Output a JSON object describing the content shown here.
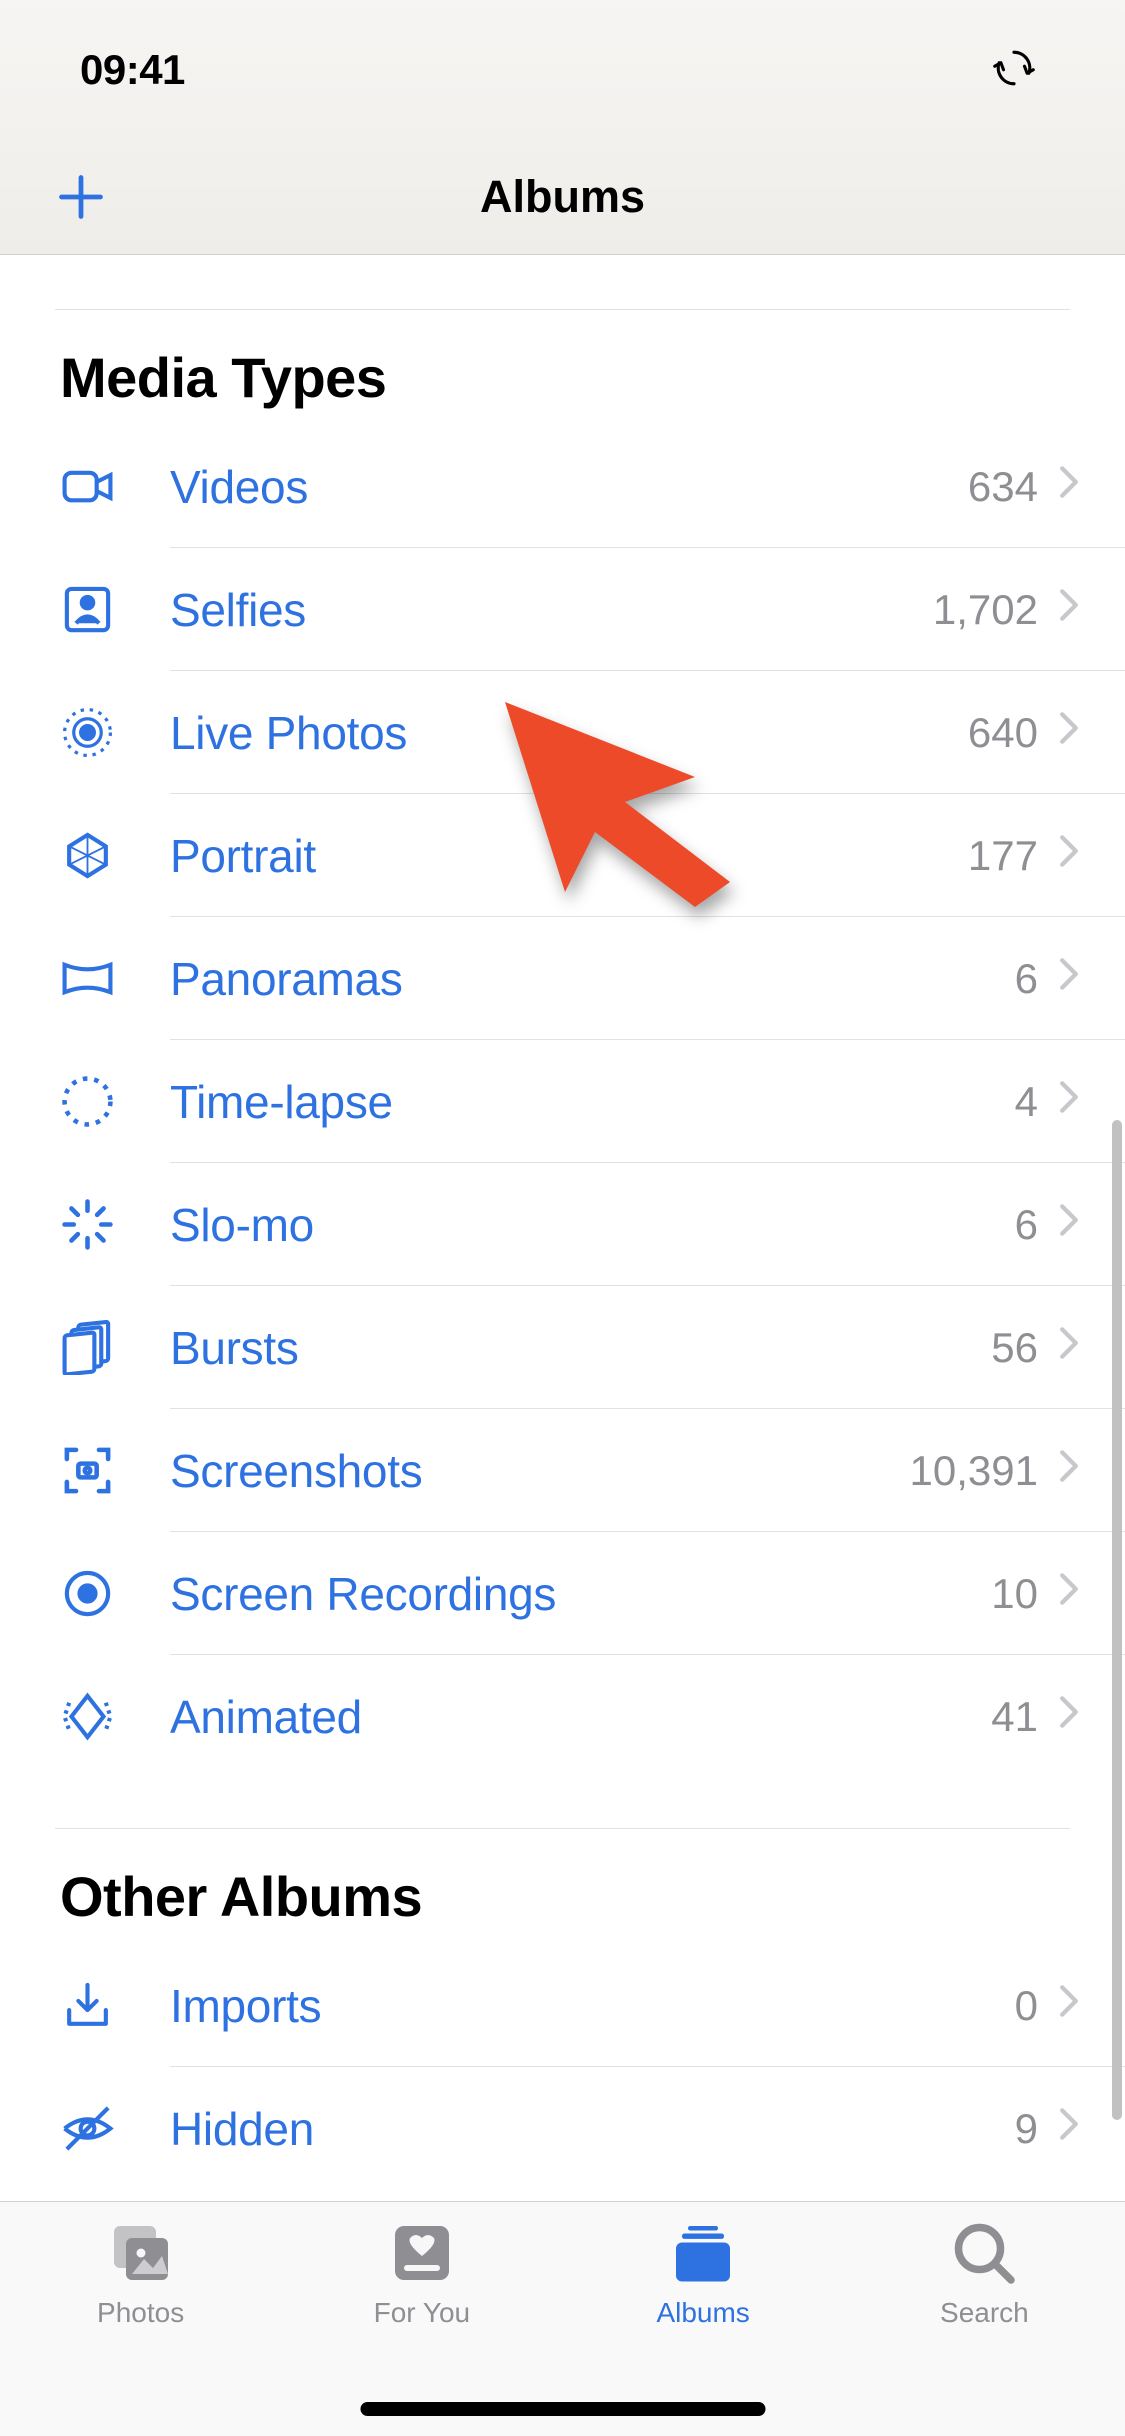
{
  "status": {
    "time": "09:41"
  },
  "nav": {
    "title": "Albums"
  },
  "sections": {
    "media_types": {
      "header": "Media Types",
      "rows": [
        {
          "label": "Videos",
          "count": "634"
        },
        {
          "label": "Selfies",
          "count": "1,702"
        },
        {
          "label": "Live Photos",
          "count": "640"
        },
        {
          "label": "Portrait",
          "count": "177"
        },
        {
          "label": "Panoramas",
          "count": "6"
        },
        {
          "label": "Time-lapse",
          "count": "4"
        },
        {
          "label": "Slo-mo",
          "count": "6"
        },
        {
          "label": "Bursts",
          "count": "56"
        },
        {
          "label": "Screenshots",
          "count": "10,391"
        },
        {
          "label": "Screen Recordings",
          "count": "10"
        },
        {
          "label": "Animated",
          "count": "41"
        }
      ]
    },
    "other_albums": {
      "header": "Other Albums",
      "rows": [
        {
          "label": "Imports",
          "count": "0"
        },
        {
          "label": "Hidden",
          "count": "9"
        }
      ]
    }
  },
  "tabs": {
    "photos": "Photos",
    "for_you": "For You",
    "albums": "Albums",
    "search": "Search"
  }
}
